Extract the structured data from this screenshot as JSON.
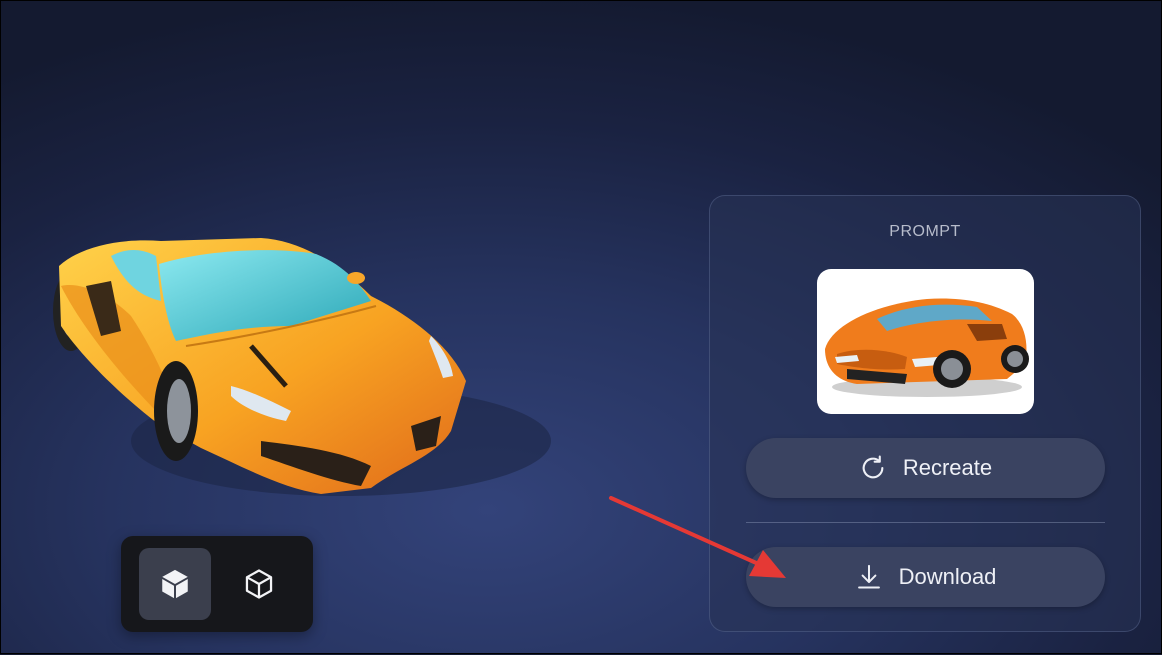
{
  "panel": {
    "title": "PROMPT",
    "recreate_label": "Recreate",
    "download_label": "Download",
    "thumbnail_icon": "sports-car-image"
  },
  "view_toggle": {
    "options": [
      {
        "icon": "solid-cube-icon",
        "selected": true
      },
      {
        "icon": "wireframe-cube-icon",
        "selected": false
      }
    ]
  },
  "model_preview": {
    "icon": "3d-sports-car-model"
  },
  "annotation": {
    "color": "#e53935"
  },
  "colors": {
    "car_body": "#f6a21c",
    "panel_button": "#3a4361",
    "toggle_selected": "#3b3f4d"
  }
}
